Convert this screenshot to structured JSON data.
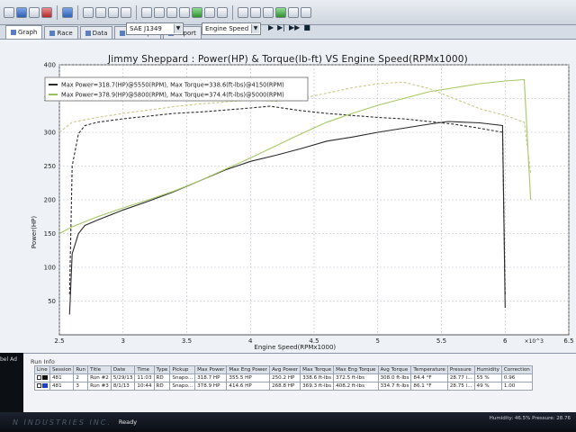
{
  "toolbar": {
    "correction_select": "SAE J1349",
    "xaxis_select": "Engine Speed"
  },
  "tabs": [
    {
      "label": "Graph"
    },
    {
      "label": "Race"
    },
    {
      "label": "Data"
    },
    {
      "label": "3DGraph"
    },
    {
      "label": "Report"
    }
  ],
  "chart_data": {
    "type": "line",
    "title": "Jimmy Sheppard : Power(HP) & Torque(lb-ft) VS Engine Speed(RPMx1000)",
    "xlabel": "Engine Speed(RPMx1000)",
    "ylabel": "Power(HP)",
    "xlim": [
      2.5,
      6.5
    ],
    "ylim": [
      0,
      400
    ],
    "x_ticks": [
      "2.5",
      "3",
      "3.5",
      "4",
      "4.5",
      "5",
      "5.5",
      "6",
      "6.5"
    ],
    "y_ticks": [
      "50",
      "100",
      "150",
      "200",
      "250",
      "300",
      "350",
      "400"
    ],
    "x_multiplier_label": "×10^3",
    "legend": [
      {
        "text": "Max Power=318.7(HP)@5550(RPM), Max Torque=338.6(ft-lbs)@4150(RPM)",
        "color": "#2a2a2a"
      },
      {
        "text": "Max Power=378.9(HP)@5800(RPM), Max Torque=374.4(ft-lbs)@5000(RPM)",
        "color": "#9cc05a"
      }
    ],
    "legend_position": "top-left",
    "grid": true,
    "series": [
      {
        "color": "#2a2a2a",
        "dash": "",
        "x": [
          2.58,
          2.6,
          2.65,
          2.7,
          2.8,
          3.0,
          3.2,
          3.4,
          3.6,
          3.8,
          4.0,
          4.2,
          4.4,
          4.6,
          4.8,
          5.0,
          5.2,
          5.4,
          5.55,
          5.8,
          5.98,
          6.0
        ],
        "y": [
          30,
          120,
          150,
          162,
          170,
          185,
          198,
          212,
          228,
          244,
          257,
          266,
          276,
          287,
          293,
          300,
          306,
          312,
          316,
          314,
          310,
          40
        ]
      },
      {
        "color": "#2a2a2a",
        "dash": "3,2",
        "x": [
          2.58,
          2.6,
          2.65,
          2.7,
          2.8,
          3.0,
          3.2,
          3.4,
          3.6,
          3.8,
          4.0,
          4.15,
          4.4,
          4.6,
          4.8,
          5.0,
          5.2,
          5.4,
          5.6,
          5.8,
          5.98,
          6.0
        ],
        "y": [
          60,
          250,
          298,
          310,
          315,
          320,
          324,
          328,
          330,
          333,
          336,
          338.6,
          332,
          328,
          325,
          322,
          320,
          316,
          312,
          306,
          300,
          60
        ]
      },
      {
        "color": "#a8c765",
        "dash": "",
        "x": [
          2.5,
          2.6,
          2.8,
          3.0,
          3.2,
          3.4,
          3.6,
          3.8,
          4.0,
          4.2,
          4.4,
          4.6,
          4.8,
          5.0,
          5.2,
          5.4,
          5.6,
          5.8,
          6.0,
          6.15,
          6.2
        ],
        "y": [
          150,
          160,
          175,
          188,
          200,
          213,
          228,
          245,
          262,
          280,
          298,
          315,
          328,
          340,
          350,
          360,
          366,
          372,
          376,
          378,
          200
        ]
      },
      {
        "color": "#c9c98a",
        "dash": "3,2",
        "x": [
          2.5,
          2.6,
          2.8,
          3.0,
          3.2,
          3.4,
          3.6,
          3.8,
          4.0,
          4.2,
          4.4,
          4.6,
          4.8,
          5.0,
          5.2,
          5.4,
          5.6,
          5.8,
          6.0,
          6.15,
          6.2
        ],
        "y": [
          300,
          315,
          322,
          328,
          333,
          338,
          342,
          345,
          348,
          346,
          350,
          358,
          366,
          372,
          374.4,
          365,
          350,
          335,
          325,
          315,
          240
        ]
      }
    ]
  },
  "runinfo": {
    "title": "Run Info",
    "side_label": "bel Ad",
    "columns": [
      "Line",
      "Session",
      "Run",
      "Title",
      "Date",
      "Time",
      "Type",
      "Pickup",
      "Max Power",
      "Max Eng Power",
      "Avg Power",
      "Max Torque",
      "Max Eng Torque",
      "Avg Torque",
      "Temperature",
      "Pressure",
      "Humidity",
      "Correction"
    ],
    "rows": [
      {
        "color": "#111111",
        "cells": [
          "481",
          "2",
          "Run #2",
          "5/29/13",
          "11:03",
          "RD",
          "Snapo...",
          "318.7 HP",
          "355.5 HP",
          "250.2 HP",
          "338.6 ft-lbs",
          "372.5 ft-lbs",
          "308.0 ft-lbs",
          "84.4 °F",
          "28.77 i...",
          "55 %",
          "0.96"
        ]
      },
      {
        "color": "#1a3fcf",
        "cells": [
          "481",
          "3",
          "Run #3",
          "8/1/13",
          "10:44",
          "RD",
          "Snapo...",
          "378.9 HP",
          "414.6 HP",
          "268.8 HP",
          "369.3 ft-lbs",
          "408.2 ft-lbs",
          "334.7 ft-lbs",
          "86.1 °F",
          "28.75 i...",
          "49 %",
          "1.00"
        ]
      }
    ]
  },
  "statusbar": {
    "brand": "N INDUSTRIES INC.",
    "status": "Ready",
    "humidity": "Humidity: 46.5%   Pressure: 28.76"
  },
  "colors": {
    "run2": "#2a2a2a",
    "run3": "#9cc05a",
    "plot_bg": "#ffffff"
  }
}
